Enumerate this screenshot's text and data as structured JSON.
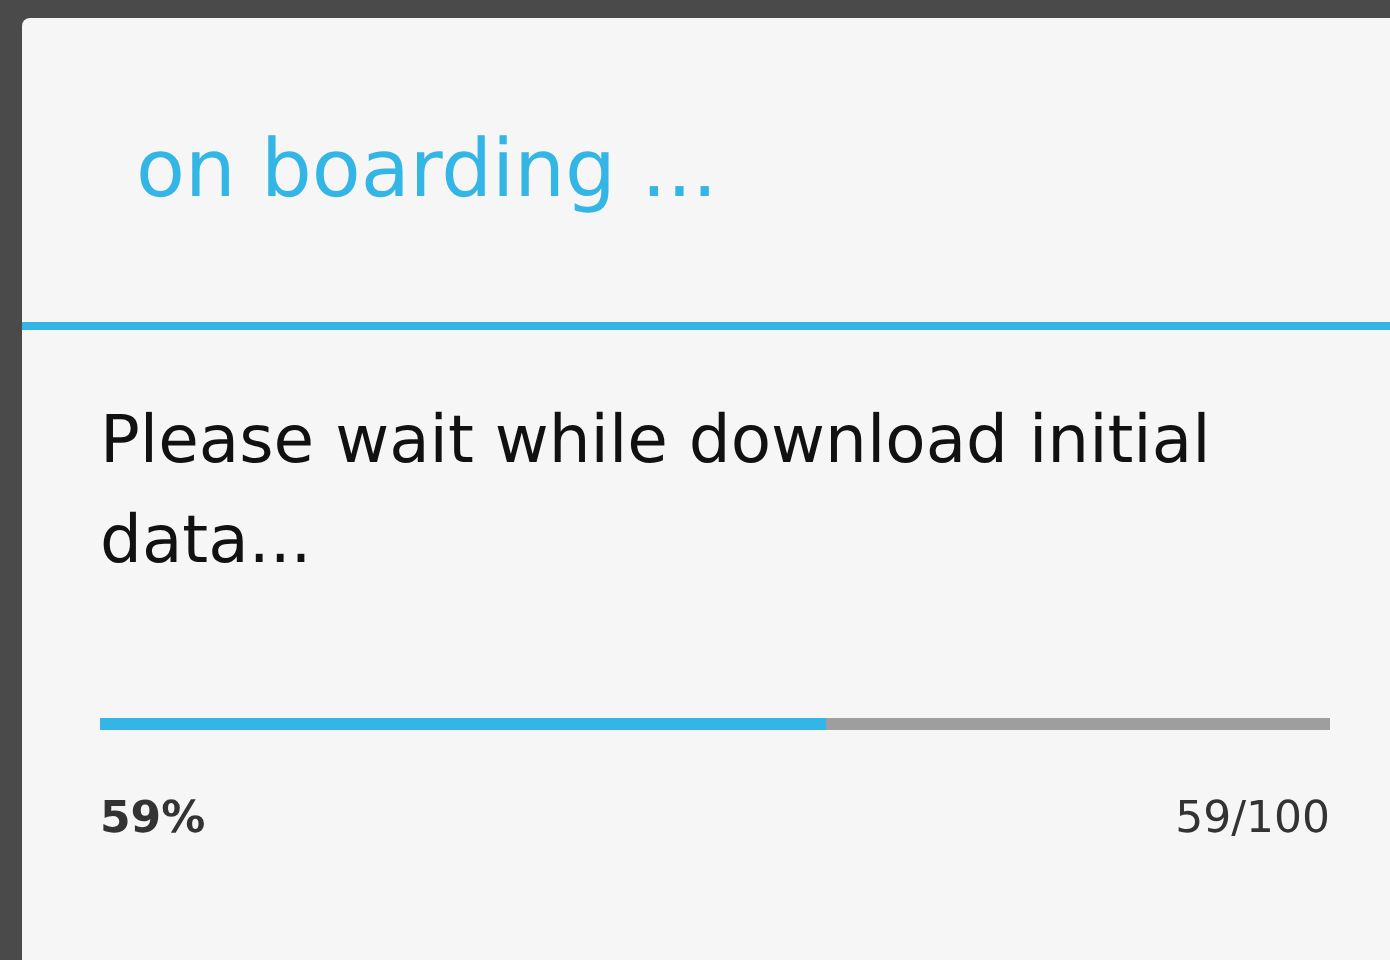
{
  "dialog": {
    "title": "on boarding ...",
    "message": "Please wait while download initial data...",
    "progress": {
      "level": 0.59,
      "percent": "59%",
      "count": "59/100"
    }
  }
}
